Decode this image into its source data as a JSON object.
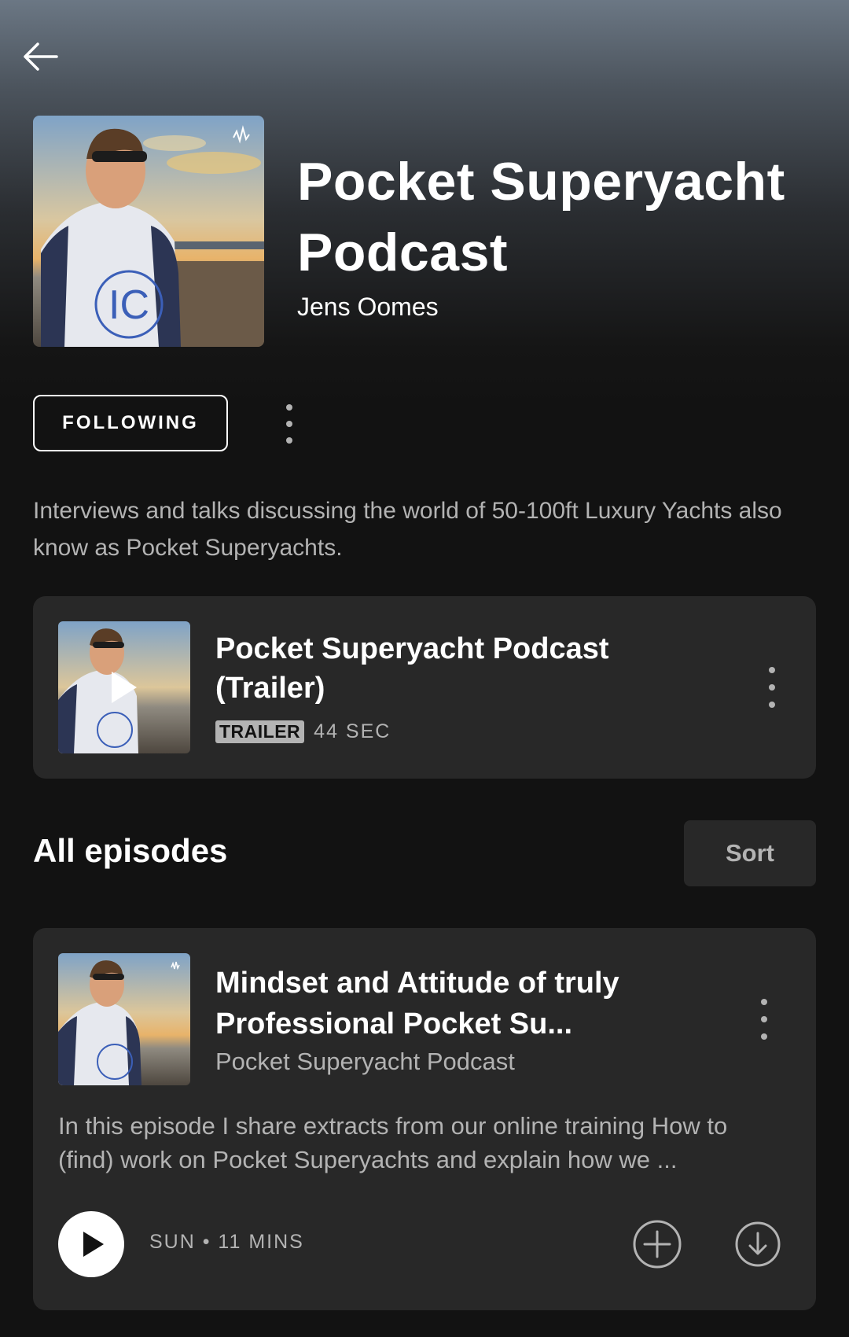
{
  "podcast": {
    "title": "Pocket Superyacht Podcast",
    "author": "Jens Oomes",
    "follow_label": "FOLLOWING",
    "description": "Interviews and talks discussing the world of 50-100ft Luxury Yachts also know as Pocket Superyachts.",
    "cover_text": "IC"
  },
  "trailer": {
    "title": "Pocket Superyacht Podcast (Trailer)",
    "badge": "TRAILER",
    "duration": "44 SEC"
  },
  "episodes_section": {
    "title": "All episodes",
    "sort_label": "Sort"
  },
  "episodes": [
    {
      "title": "Mindset and Attitude of truly Professional Pocket Su...",
      "show": "Pocket Superyacht Podcast",
      "description": "In this episode I share extracts from our online training How to (find) work on Pocket Superyachts and explain how we ...",
      "meta": "SUN • 11 MINS"
    }
  ],
  "icons": {
    "back": "arrow-left-icon",
    "more": "more-vertical-icon",
    "play": "play-icon",
    "add": "add-circle-icon",
    "download": "download-circle-icon"
  },
  "colors": {
    "background": "#121212",
    "card": "#282828",
    "muted_text": "#b3b3b3",
    "ic_logo": "#3b5fb8"
  }
}
